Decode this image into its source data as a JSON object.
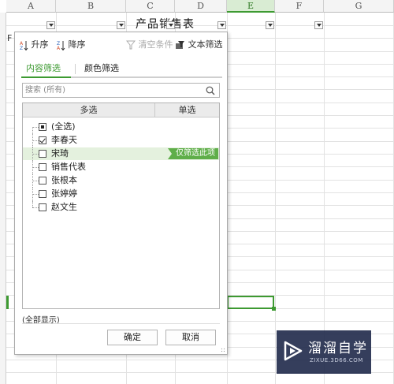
{
  "sheet": {
    "columns": [
      "A",
      "B",
      "C",
      "D",
      "E",
      "F",
      "G"
    ],
    "selected_column": "E",
    "title": "产品销售表",
    "partial_header": "F"
  },
  "popup": {
    "toolbar": {
      "sort_asc": "升序",
      "sort_desc": "降序",
      "clear": "清空条件",
      "text_filter": "文本筛选"
    },
    "tabs": [
      "内容筛选",
      "颜色筛选"
    ],
    "search": {
      "placeholder": "搜索 (所有)",
      "value": ""
    },
    "list_header": {
      "multi": "多选",
      "single": "单选"
    },
    "items": [
      {
        "label": "(全选)",
        "state": "partial"
      },
      {
        "label": "李春天",
        "state": "checked"
      },
      {
        "label": "宋琦",
        "state": "unchecked"
      },
      {
        "label": "销售代表",
        "state": "unchecked"
      },
      {
        "label": "张根本",
        "state": "unchecked"
      },
      {
        "label": "张婷婷",
        "state": "unchecked"
      },
      {
        "label": "赵文生",
        "state": "unchecked"
      }
    ],
    "hover_action": "仅筛选此项",
    "show_all": "(全部显示)",
    "ok": "确定",
    "cancel": "取消"
  },
  "watermark": {
    "title": "溜溜自学",
    "subtitle": "ZIXUE.3D66.COM"
  },
  "colors": {
    "accent": "#3d9a31",
    "hover_row": "#e4f1de",
    "hover_button": "#5fae49"
  }
}
